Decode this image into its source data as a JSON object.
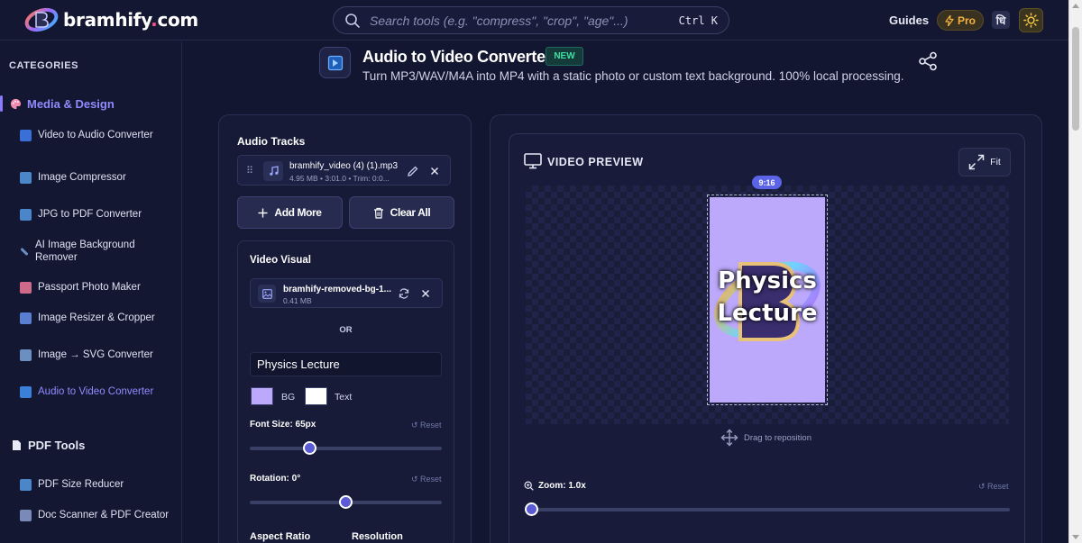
{
  "brand": {
    "name": "bramhify",
    "dot": ".",
    "tld": "com"
  },
  "search": {
    "placeholder": "Search tools (e.g. \"compress\", \"crop\", \"age\"...)",
    "shortcut": "Ctrl K"
  },
  "topnav": {
    "guides": "Guides",
    "pro": "Pro",
    "lang": "धि"
  },
  "sidebar": {
    "heading": "CATEGORIES",
    "sections": [
      {
        "label": "Media & Design",
        "items": [
          {
            "label": "Video to Audio Converter",
            "icon": "audio-file-icon"
          },
          {
            "label": "Image Compressor",
            "icon": "image-icon"
          },
          {
            "label": "JPG to PDF Converter",
            "icon": "image-icon"
          },
          {
            "label": "AI Image Background Remover",
            "icon": "magic-wand-icon"
          },
          {
            "label": "Passport Photo Maker",
            "icon": "portrait-icon"
          },
          {
            "label": "Image Resizer & Cropper",
            "icon": "resize-icon"
          },
          {
            "label": "Image → SVG Converter",
            "icon": "vector-icon"
          },
          {
            "label": "Audio to Video Converter",
            "icon": "video-icon",
            "active": true
          }
        ]
      },
      {
        "label": "PDF Tools",
        "items": [
          {
            "label": "PDF Size Reducer",
            "icon": "document-icon"
          },
          {
            "label": "Doc Scanner & PDF Creator",
            "icon": "scanner-icon"
          }
        ]
      }
    ]
  },
  "tool": {
    "title": "Audio to Video Converter",
    "badge": "NEW",
    "subtitle": "Turn MP3/WAV/M4A into MP4 with a static photo or custom text background. 100% local processing."
  },
  "audio": {
    "heading": "Audio Tracks",
    "track": {
      "name": "bramhify_video (4) (1).mp3",
      "meta": "4.95 MB • 3:01.0 • Trim: 0:0..."
    },
    "add_more": "Add More",
    "clear_all": "Clear All"
  },
  "visual": {
    "heading": "Video Visual",
    "file": {
      "name": "bramhify-removed-bg-1...",
      "size": "0.41 MB"
    },
    "or": "OR",
    "text_value": "Physics Lecture",
    "bg_label": "BG",
    "text_label": "Text",
    "bg_color": "#bca9fb",
    "text_color": "#ffffff",
    "font_size_label": "Font Size: 65px",
    "font_size_fraction": 0.31,
    "rotation_label": "Rotation: 0°",
    "rotation_fraction": 0.5,
    "reset_label": "↺ Reset",
    "aspect_label": "Aspect Ratio",
    "resolution_label": "Resolution"
  },
  "preview": {
    "heading": "VIDEO PREVIEW",
    "fit": "Fit",
    "ratio": "9:16",
    "text_line1": "Physics",
    "text_line2": "Lecture",
    "drag_hint": "Drag to reposition",
    "zoom_label": "Zoom: 1.0x",
    "zoom_fraction": 0,
    "reset_label": "↺ Reset"
  },
  "colors": {
    "accent": "#5b63e6",
    "active_text": "#8f8bff",
    "new_badge": "#3fe0a4",
    "pro": "#f5b23c"
  }
}
